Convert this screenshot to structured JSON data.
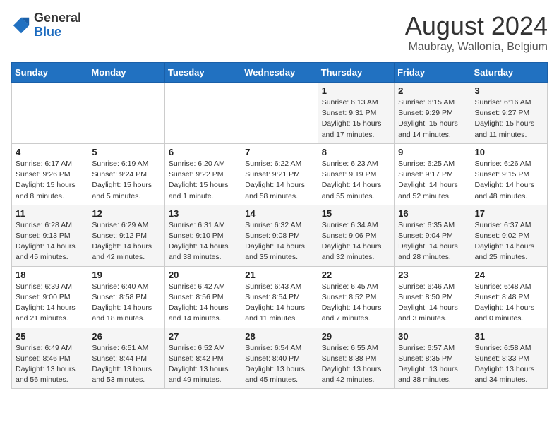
{
  "header": {
    "logo_general": "General",
    "logo_blue": "Blue",
    "title": "August 2024",
    "subtitle": "Maubray, Wallonia, Belgium"
  },
  "days_of_week": [
    "Sunday",
    "Monday",
    "Tuesday",
    "Wednesday",
    "Thursday",
    "Friday",
    "Saturday"
  ],
  "weeks": [
    [
      {
        "day": "",
        "info": ""
      },
      {
        "day": "",
        "info": ""
      },
      {
        "day": "",
        "info": ""
      },
      {
        "day": "",
        "info": ""
      },
      {
        "day": "1",
        "info": "Sunrise: 6:13 AM\nSunset: 9:31 PM\nDaylight: 15 hours\nand 17 minutes."
      },
      {
        "day": "2",
        "info": "Sunrise: 6:15 AM\nSunset: 9:29 PM\nDaylight: 15 hours\nand 14 minutes."
      },
      {
        "day": "3",
        "info": "Sunrise: 6:16 AM\nSunset: 9:27 PM\nDaylight: 15 hours\nand 11 minutes."
      }
    ],
    [
      {
        "day": "4",
        "info": "Sunrise: 6:17 AM\nSunset: 9:26 PM\nDaylight: 15 hours\nand 8 minutes."
      },
      {
        "day": "5",
        "info": "Sunrise: 6:19 AM\nSunset: 9:24 PM\nDaylight: 15 hours\nand 5 minutes."
      },
      {
        "day": "6",
        "info": "Sunrise: 6:20 AM\nSunset: 9:22 PM\nDaylight: 15 hours\nand 1 minute."
      },
      {
        "day": "7",
        "info": "Sunrise: 6:22 AM\nSunset: 9:21 PM\nDaylight: 14 hours\nand 58 minutes."
      },
      {
        "day": "8",
        "info": "Sunrise: 6:23 AM\nSunset: 9:19 PM\nDaylight: 14 hours\nand 55 minutes."
      },
      {
        "day": "9",
        "info": "Sunrise: 6:25 AM\nSunset: 9:17 PM\nDaylight: 14 hours\nand 52 minutes."
      },
      {
        "day": "10",
        "info": "Sunrise: 6:26 AM\nSunset: 9:15 PM\nDaylight: 14 hours\nand 48 minutes."
      }
    ],
    [
      {
        "day": "11",
        "info": "Sunrise: 6:28 AM\nSunset: 9:13 PM\nDaylight: 14 hours\nand 45 minutes."
      },
      {
        "day": "12",
        "info": "Sunrise: 6:29 AM\nSunset: 9:12 PM\nDaylight: 14 hours\nand 42 minutes."
      },
      {
        "day": "13",
        "info": "Sunrise: 6:31 AM\nSunset: 9:10 PM\nDaylight: 14 hours\nand 38 minutes."
      },
      {
        "day": "14",
        "info": "Sunrise: 6:32 AM\nSunset: 9:08 PM\nDaylight: 14 hours\nand 35 minutes."
      },
      {
        "day": "15",
        "info": "Sunrise: 6:34 AM\nSunset: 9:06 PM\nDaylight: 14 hours\nand 32 minutes."
      },
      {
        "day": "16",
        "info": "Sunrise: 6:35 AM\nSunset: 9:04 PM\nDaylight: 14 hours\nand 28 minutes."
      },
      {
        "day": "17",
        "info": "Sunrise: 6:37 AM\nSunset: 9:02 PM\nDaylight: 14 hours\nand 25 minutes."
      }
    ],
    [
      {
        "day": "18",
        "info": "Sunrise: 6:39 AM\nSunset: 9:00 PM\nDaylight: 14 hours\nand 21 minutes."
      },
      {
        "day": "19",
        "info": "Sunrise: 6:40 AM\nSunset: 8:58 PM\nDaylight: 14 hours\nand 18 minutes."
      },
      {
        "day": "20",
        "info": "Sunrise: 6:42 AM\nSunset: 8:56 PM\nDaylight: 14 hours\nand 14 minutes."
      },
      {
        "day": "21",
        "info": "Sunrise: 6:43 AM\nSunset: 8:54 PM\nDaylight: 14 hours\nand 11 minutes."
      },
      {
        "day": "22",
        "info": "Sunrise: 6:45 AM\nSunset: 8:52 PM\nDaylight: 14 hours\nand 7 minutes."
      },
      {
        "day": "23",
        "info": "Sunrise: 6:46 AM\nSunset: 8:50 PM\nDaylight: 14 hours\nand 3 minutes."
      },
      {
        "day": "24",
        "info": "Sunrise: 6:48 AM\nSunset: 8:48 PM\nDaylight: 14 hours\nand 0 minutes."
      }
    ],
    [
      {
        "day": "25",
        "info": "Sunrise: 6:49 AM\nSunset: 8:46 PM\nDaylight: 13 hours\nand 56 minutes."
      },
      {
        "day": "26",
        "info": "Sunrise: 6:51 AM\nSunset: 8:44 PM\nDaylight: 13 hours\nand 53 minutes."
      },
      {
        "day": "27",
        "info": "Sunrise: 6:52 AM\nSunset: 8:42 PM\nDaylight: 13 hours\nand 49 minutes."
      },
      {
        "day": "28",
        "info": "Sunrise: 6:54 AM\nSunset: 8:40 PM\nDaylight: 13 hours\nand 45 minutes."
      },
      {
        "day": "29",
        "info": "Sunrise: 6:55 AM\nSunset: 8:38 PM\nDaylight: 13 hours\nand 42 minutes."
      },
      {
        "day": "30",
        "info": "Sunrise: 6:57 AM\nSunset: 8:35 PM\nDaylight: 13 hours\nand 38 minutes."
      },
      {
        "day": "31",
        "info": "Sunrise: 6:58 AM\nSunset: 8:33 PM\nDaylight: 13 hours\nand 34 minutes."
      }
    ]
  ]
}
